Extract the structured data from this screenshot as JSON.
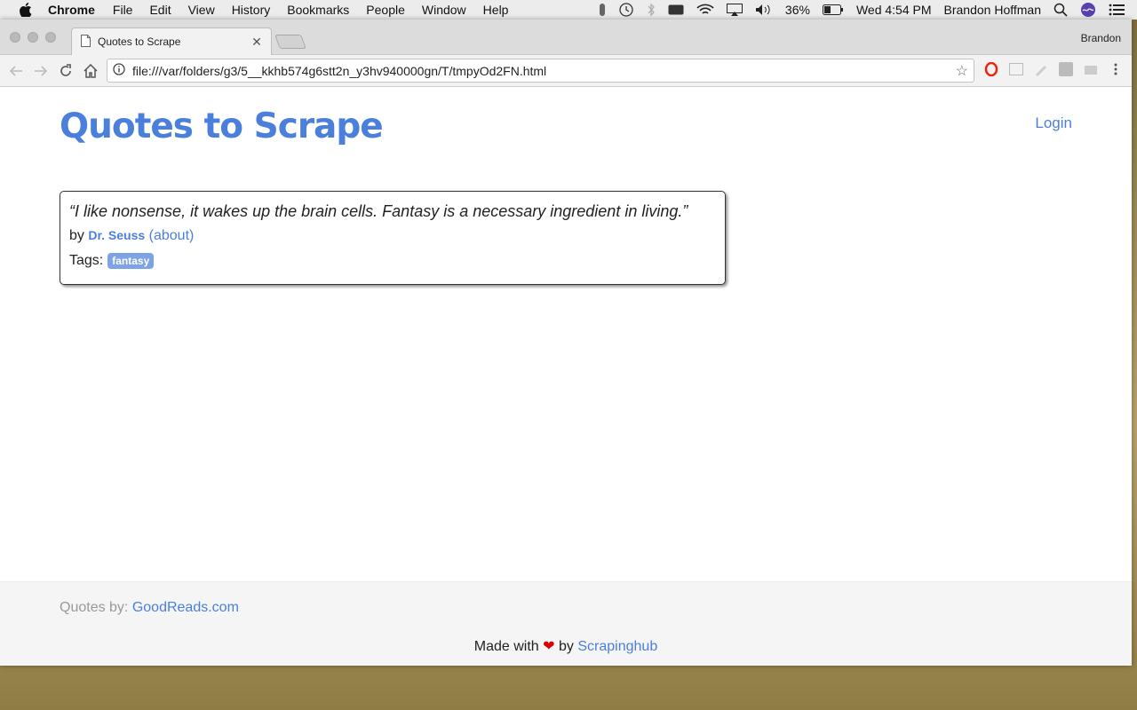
{
  "menubar": {
    "app": "Chrome",
    "items": [
      "File",
      "Edit",
      "View",
      "History",
      "Bookmarks",
      "People",
      "Window",
      "Help"
    ],
    "battery": "36%",
    "clock": "Wed 4:54 PM",
    "user": "Brandon Hoffman"
  },
  "browser": {
    "tab_title": "Quotes to Scrape",
    "profile_name": "Brandon",
    "url": "file:///var/folders/g3/5__kkhb574g6stt2n_y3hv940000gn/T/tmpyOd2FN.html"
  },
  "page": {
    "title": "Quotes to Scrape",
    "login": "Login",
    "quote": {
      "text": "“I like nonsense, it wakes up the brain cells. Fantasy is a necessary ingredient in living.”",
      "by": "by",
      "author": "Dr. Seuss",
      "about": "(about)",
      "tags_label": "Tags:",
      "tags": [
        "fantasy"
      ]
    },
    "footer": {
      "credit_prefix": "Quotes by:",
      "credit_link": "GoodReads.com",
      "made_prefix": "Made with",
      "heart": "❤",
      "made_by": "by",
      "made_link": "Scrapinghub"
    }
  }
}
